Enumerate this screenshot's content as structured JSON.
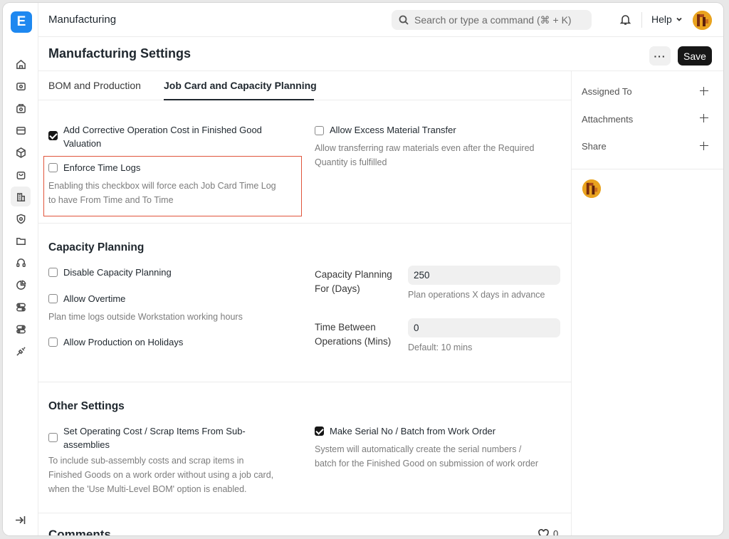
{
  "app": {
    "logo_letter": "E",
    "title": "Manufacturing"
  },
  "search": {
    "placeholder": "Search or type a command (⌘ + K)"
  },
  "help_label": "Help",
  "page": {
    "title": "Manufacturing Settings",
    "more_label": "···",
    "save_label": "Save"
  },
  "tabs": [
    {
      "label": "BOM and Production",
      "active": false
    },
    {
      "label": "Job Card and Capacity Planning",
      "active": true
    }
  ],
  "job_card": {
    "corrective_cost": {
      "label_line1": "Add Corrective Operation Cost in Finished Good",
      "label_line2": "Valuation",
      "checked": true
    },
    "enforce_time_logs": {
      "label": "Enforce Time Logs",
      "checked": false,
      "desc_line1": "Enabling this checkbox will force each Job Card Time Log",
      "desc_line2": "to have From Time and To Time"
    },
    "excess_transfer": {
      "label": "Allow Excess Material Transfer",
      "checked": false,
      "desc_line1": "Allow transferring raw materials even after the Required",
      "desc_line2": "Quantity is fulfilled"
    }
  },
  "capacity": {
    "title": "Capacity Planning",
    "disable": {
      "label": "Disable Capacity Planning",
      "checked": false
    },
    "overtime": {
      "label": "Allow Overtime",
      "checked": false,
      "desc": "Plan time logs outside Workstation working hours"
    },
    "holidays": {
      "label": "Allow Production on Holidays",
      "checked": false
    },
    "days_for": {
      "label_line1": "Capacity Planning",
      "label_line2": "For (Days)",
      "value": "250",
      "desc": "Plan operations X days in advance"
    },
    "time_between": {
      "label_line1": "Time Between",
      "label_line2": "Operations (Mins)",
      "value": "0",
      "desc": "Default: 10 mins"
    }
  },
  "other": {
    "title": "Other Settings",
    "op_cost": {
      "label_line1": "Set Operating Cost / Scrap Items From Sub-",
      "label_line2": "assemblies",
      "checked": false,
      "desc_line1": "To include sub-assembly costs and scrap items in",
      "desc_line2": "Finished Goods on a work order without using a job card,",
      "desc_line3": "when the 'Use Multi-Level BOM' option is enabled."
    },
    "serial_batch": {
      "label": "Make Serial No / Batch from Work Order",
      "checked": true,
      "desc_line1": "System will automatically create the serial numbers /",
      "desc_line2": "batch for the Finished Good on submission of work order"
    }
  },
  "comments": {
    "title": "Comments",
    "likes": "0"
  },
  "right_panel": {
    "assigned_to": "Assigned To",
    "attachments": "Attachments",
    "share": "Share"
  },
  "colors": {
    "accent": "#171717",
    "logo": "#1e88f0",
    "highlight_border": "#e0553c"
  }
}
